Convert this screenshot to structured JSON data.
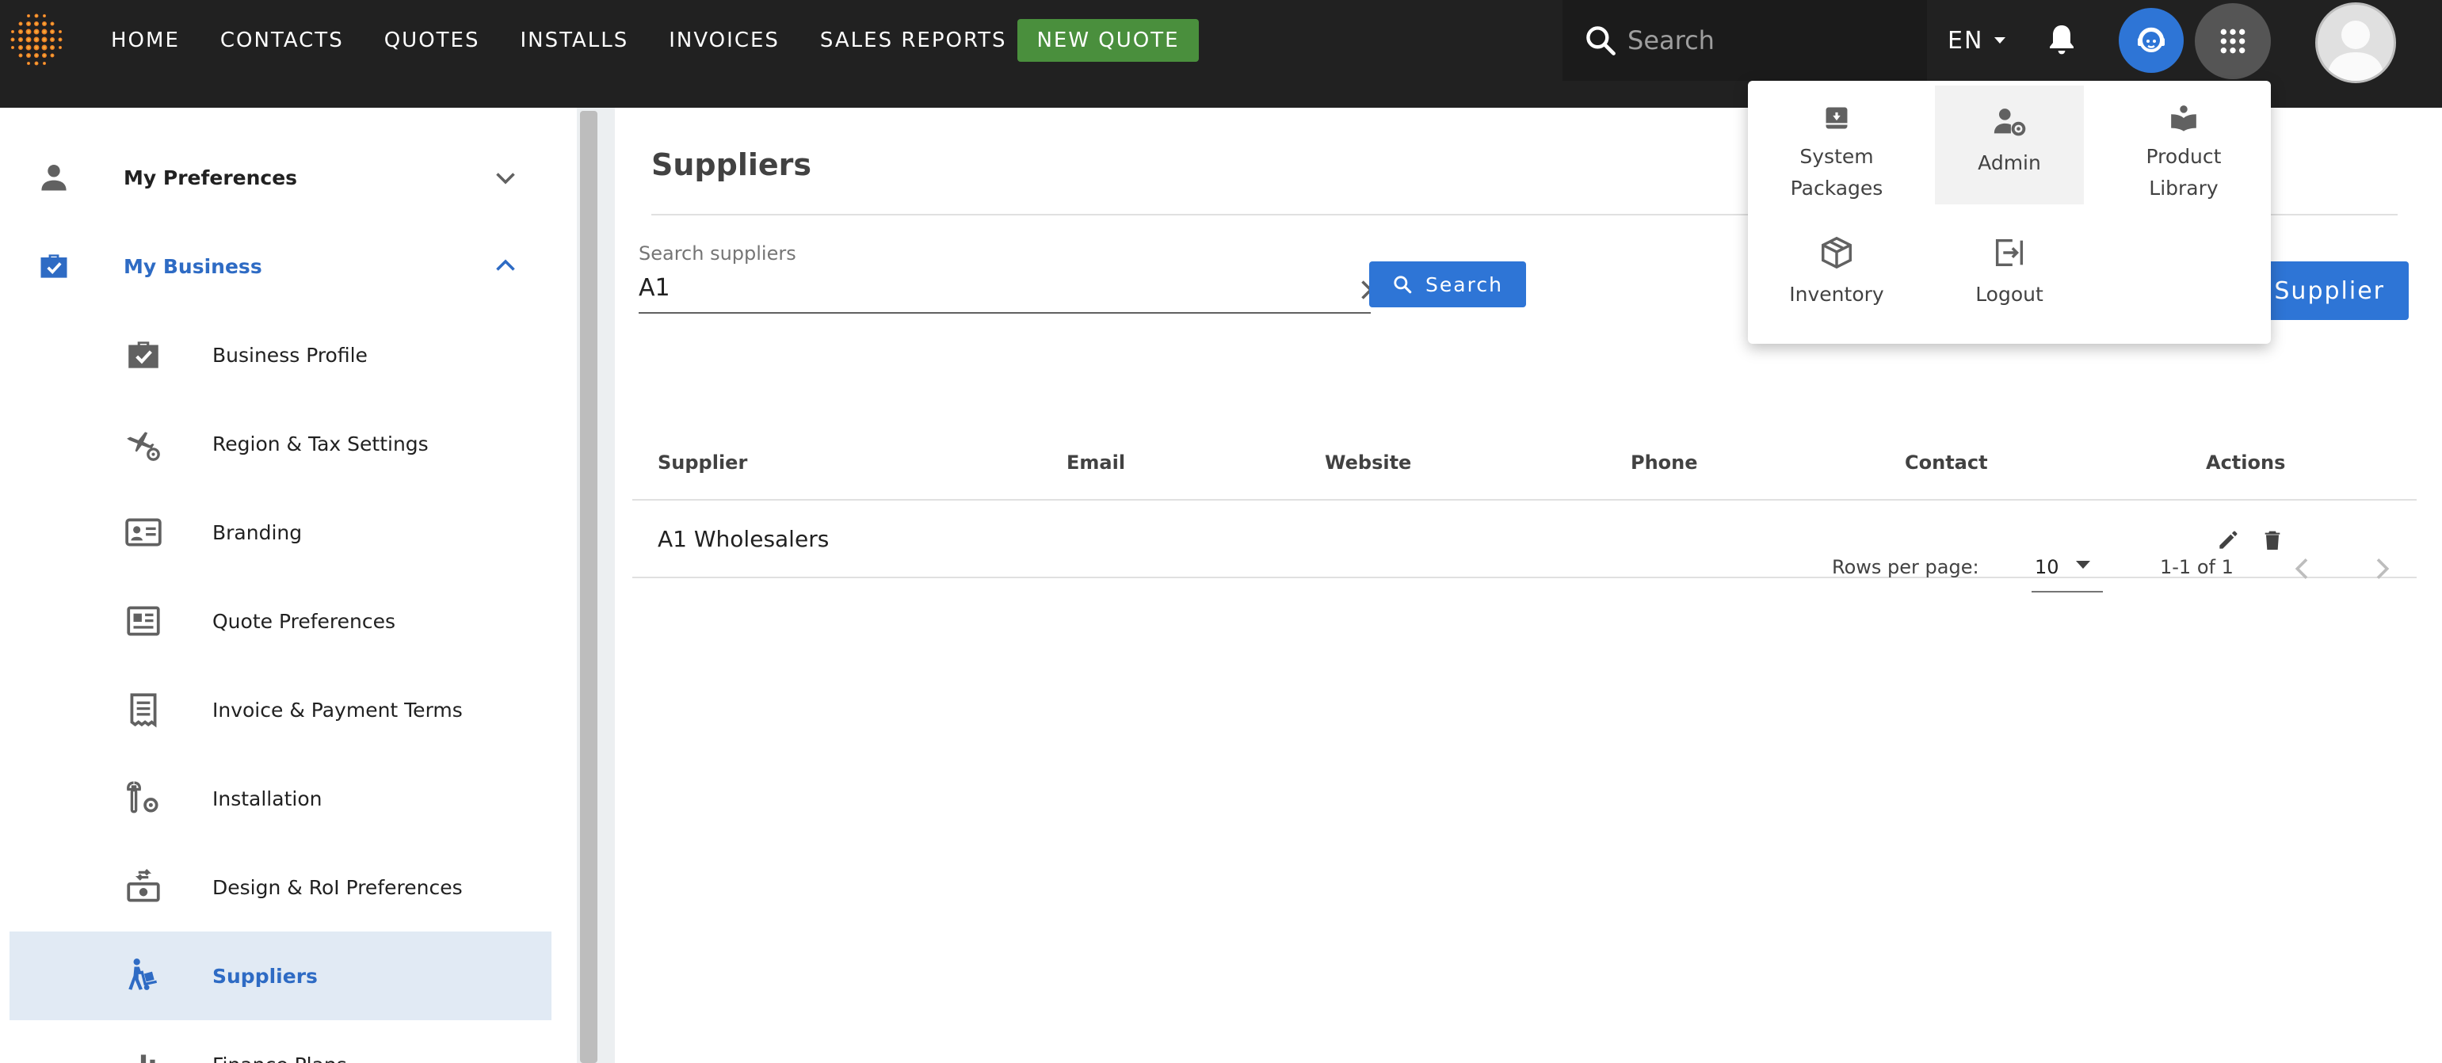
{
  "nav": {
    "links": [
      "HOME",
      "CONTACTS",
      "QUOTES",
      "INSTALLS",
      "INVOICES",
      "SALES REPORTS"
    ],
    "new_quote": "NEW QUOTE",
    "search_placeholder": "Search",
    "language": "EN"
  },
  "apps_menu": {
    "items": [
      {
        "label": "System\nPackages",
        "icon": "archive-icon"
      },
      {
        "label": "Admin",
        "icon": "user-cog-icon"
      },
      {
        "label": "Product\nLibrary",
        "icon": "book-icon"
      },
      {
        "label": "Inventory",
        "icon": "package-icon"
      },
      {
        "label": "Logout",
        "icon": "logout-icon"
      }
    ]
  },
  "sidebar": {
    "sections": [
      {
        "label": "My Preferences",
        "icon": "person-icon"
      },
      {
        "label": "My Business",
        "icon": "briefcase-check-icon"
      }
    ],
    "items": [
      {
        "label": "Business Profile",
        "icon": "briefcase-check-icon"
      },
      {
        "label": "Region & Tax Settings",
        "icon": "plane-gear-icon"
      },
      {
        "label": "Branding",
        "icon": "id-card-icon"
      },
      {
        "label": "Quote Preferences",
        "icon": "newspaper-icon"
      },
      {
        "label": "Invoice & Payment Terms",
        "icon": "receipt-icon"
      },
      {
        "label": "Installation",
        "icon": "wrench-gear-icon"
      },
      {
        "label": "Design & RoI Preferences",
        "icon": "cash-refresh-icon"
      },
      {
        "label": "Suppliers",
        "icon": "hand-truck-icon"
      },
      {
        "label": "Finance Plans",
        "icon": "chart-bar-icon"
      }
    ],
    "active": "Suppliers"
  },
  "main": {
    "title": "Suppliers",
    "search": {
      "label": "Search suppliers",
      "value": "A1",
      "button": "Search"
    },
    "add_button": "Supplier",
    "table": {
      "columns": [
        "Supplier",
        "Email",
        "Website",
        "Phone",
        "Contact",
        "Actions"
      ],
      "rows": [
        {
          "supplier": "A1 Wholesalers",
          "email": "",
          "website": "",
          "phone": "",
          "contact": ""
        }
      ]
    },
    "pagination": {
      "rows_label": "Rows per page:",
      "rows_per_page": "10",
      "range": "1-1 of 1"
    }
  },
  "colors": {
    "topbar": "#212121",
    "accent": "#2e75d6",
    "new_quote": "#4a8f3d",
    "active_bg": "#e1eaf4",
    "active_text": "#2e6bc4"
  }
}
